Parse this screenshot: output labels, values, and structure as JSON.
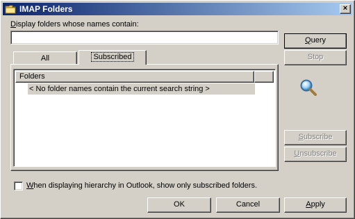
{
  "window": {
    "title": "IMAP Folders",
    "close_label": "×",
    "icons": {
      "title": "folder-icon",
      "close": "close-icon",
      "search": "magnifier-icon"
    }
  },
  "search": {
    "label_accel": "D",
    "label_rest": "isplay folders whose names contain:",
    "value": ""
  },
  "tabs": [
    {
      "label": "All",
      "selected": false
    },
    {
      "label": "Subscribed",
      "selected": true
    }
  ],
  "list": {
    "column_header": "Folders",
    "rows": [
      "< No folder names contain the current search string >"
    ]
  },
  "buttons": {
    "query": {
      "accel": "Q",
      "rest": "uery",
      "enabled": true
    },
    "stop": {
      "accel": "",
      "rest": "Stop",
      "enabled": false
    },
    "subscribe": {
      "accel": "S",
      "rest": "ubscribe",
      "enabled": false
    },
    "unsubscribe": {
      "accel": "U",
      "rest": "nsubscribe",
      "enabled": false
    },
    "ok": "OK",
    "cancel": "Cancel",
    "apply": {
      "accel": "A",
      "rest": "pply"
    }
  },
  "option": {
    "checked": false,
    "label_accel": "W",
    "label_rest": "hen displaying hierarchy in Outlook, show only subscribed folders."
  }
}
